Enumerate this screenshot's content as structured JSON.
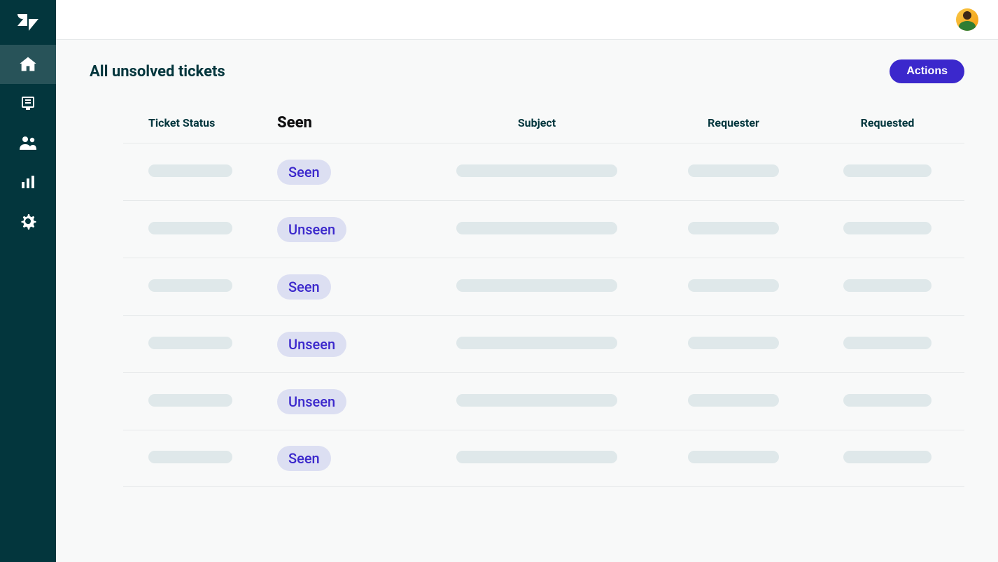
{
  "page": {
    "title": "All unsolved tickets"
  },
  "actions": {
    "label": "Actions"
  },
  "columns": {
    "ticket_status": "Ticket Status",
    "seen": "Seen",
    "subject": "Subject",
    "requester": "Requester",
    "requested": "Requested"
  },
  "rows": [
    {
      "seen_label": "Seen"
    },
    {
      "seen_label": "Unseen"
    },
    {
      "seen_label": "Seen"
    },
    {
      "seen_label": "Unseen"
    },
    {
      "seen_label": "Unseen"
    },
    {
      "seen_label": "Seen"
    }
  ],
  "sidebar": {
    "items": [
      {
        "name": "home",
        "active": true
      },
      {
        "name": "views",
        "active": false
      },
      {
        "name": "customers",
        "active": false
      },
      {
        "name": "reporting",
        "active": false
      },
      {
        "name": "admin",
        "active": false
      }
    ]
  },
  "colors": {
    "sidebar_bg": "#03363d",
    "primary_text": "#03363d",
    "accent_purple": "#3b28cc",
    "pill_bg": "#dcdff2",
    "placeholder": "#dfe8ea"
  }
}
